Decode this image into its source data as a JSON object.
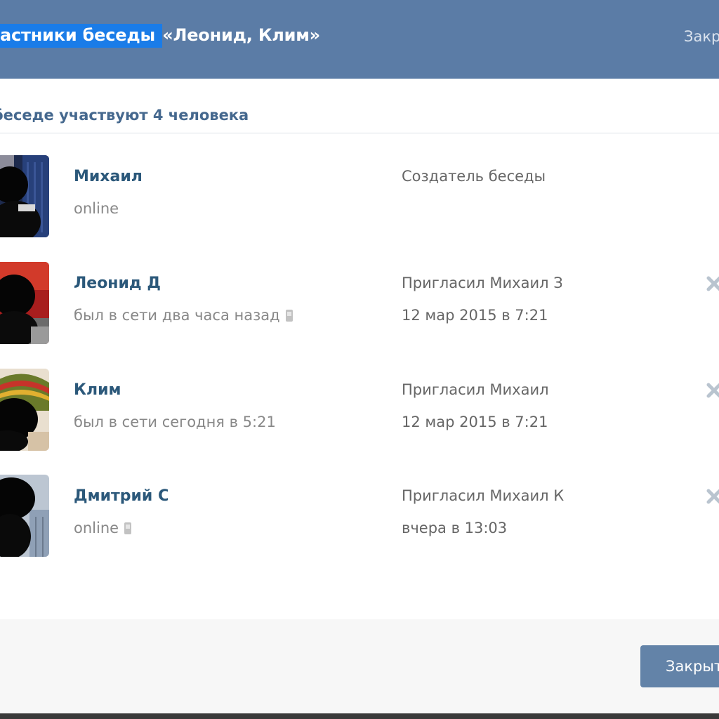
{
  "header": {
    "title_selected": "астники беседы ",
    "title_rest": "«Леонид, Клим»",
    "close_label": "Закрыть"
  },
  "section": {
    "title": "беседе участвуют 4 человека"
  },
  "members": [
    {
      "name": "Михаил",
      "status": "online",
      "mobile": false,
      "invite_by": "Создатель беседы",
      "invite_date": "",
      "removable": false
    },
    {
      "name": "Леонид Д",
      "status": "был в сети два часа назад",
      "mobile": true,
      "invite_by": "Пригласил Михаил З",
      "invite_date": "12 мар 2015 в 7:21",
      "removable": true
    },
    {
      "name": "Клим",
      "status": "был в сети сегодня в 5:21",
      "mobile": false,
      "invite_by": "Пригласил Михаил",
      "invite_date": "12 мар 2015 в 7:21",
      "removable": true
    },
    {
      "name": "Дмитрий С",
      "status": "online",
      "mobile": true,
      "invite_by": "Пригласил Михаил К",
      "invite_date": "вчера в 13:03",
      "removable": true
    }
  ],
  "footer": {
    "close_button_label": "Закрыть"
  },
  "icons": {
    "remove": "close-x-icon",
    "mobile": "mobile-phone-icon"
  },
  "colors": {
    "header_bg": "#5b7ca6",
    "selection": "#1a7ce8",
    "name": "#2b587a",
    "section_title": "#45688e",
    "button_bg": "#6383a8"
  }
}
